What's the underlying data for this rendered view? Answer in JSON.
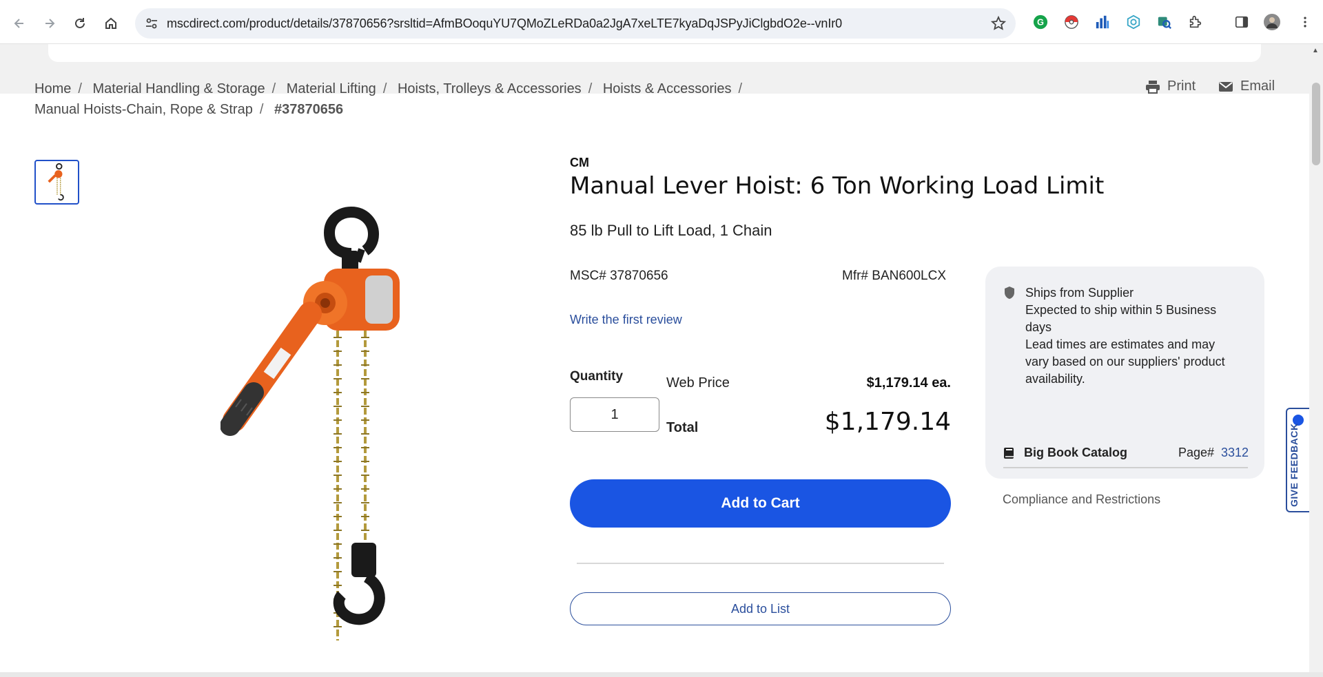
{
  "browser": {
    "url": "mscdirect.com/product/details/37870656?srsltid=AfmBOoquYU7QMoZLeRDa0a2JgA7xeLTE7kyaDqJSPyJiClgbdO2e--vnIr0"
  },
  "breadcrumb": {
    "items": [
      "Home",
      "Material Handling & Storage",
      "Material Lifting",
      "Hoists, Trolleys & Accessories",
      "Hoists & Accessories",
      "Manual Hoists-Chain, Rope & Strap"
    ],
    "current": "#37870656"
  },
  "actions": {
    "print_label": "Print",
    "email_label": "Email"
  },
  "product": {
    "brand": "CM",
    "title": "Manual Lever Hoist: 6 Ton Working Load Limit",
    "subtitle": "85 lb Pull to Lift Load, 1 Chain",
    "msc_number": "MSC# 37870656",
    "mfr_number": "Mfr# BAN600LCX",
    "review_link": "Write the first review"
  },
  "purchase": {
    "quantity_label": "Quantity",
    "quantity_value": "1",
    "web_price_label": "Web Price",
    "web_price_value": "$1,179.14 ea.",
    "total_label": "Total",
    "total_value": "$1,179.14",
    "add_to_cart": "Add to Cart",
    "add_to_list": "Add to List"
  },
  "shipping": {
    "line1": "Ships from Supplier",
    "line2": "Expected to ship within 5 Business days",
    "line3": "Lead times are estimates and may vary based on our suppliers' product availability.",
    "catalog_label": "Big Book Catalog",
    "page_label": "Page#",
    "page_number": "3312",
    "compliance": "Compliance and Restrictions"
  },
  "feedback": {
    "label": "GIVE FEEDBACK"
  },
  "colors": {
    "accent": "#1a55e3",
    "link": "#2a4e9c",
    "hoist_orange": "#e8621e"
  }
}
